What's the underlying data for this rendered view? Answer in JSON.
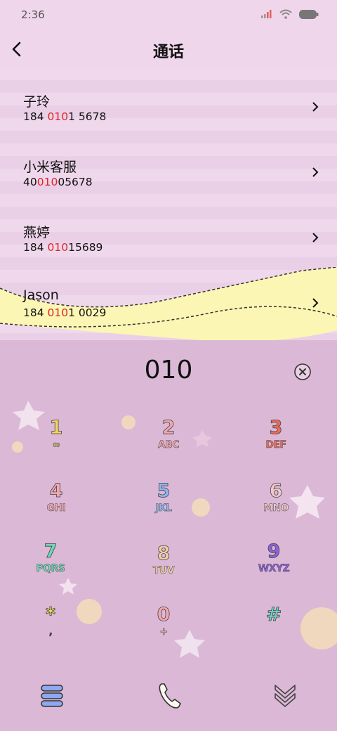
{
  "status": {
    "time": "2:36"
  },
  "header": {
    "title": "通话"
  },
  "results": [
    {
      "name": "子玲",
      "pre": "184 ",
      "hl": "010",
      "post": "1 5678"
    },
    {
      "name": "小米客服",
      "pre": "40",
      "hl": "010",
      "post": "05678"
    },
    {
      "name": "燕婷",
      "pre": "184 ",
      "hl": "010",
      "post": "15689"
    },
    {
      "name": "Jason",
      "pre": "184 ",
      "hl": "010",
      "post": "1 0029"
    }
  ],
  "dialer": {
    "digits": "010"
  },
  "keys": [
    {
      "digit": "1",
      "letters": "∞",
      "dcolor": "#f3d36a",
      "lcolor": "#f3d36a"
    },
    {
      "digit": "2",
      "letters": "ABC",
      "dcolor": "#f2a7b0",
      "lcolor": "#f2a7b0"
    },
    {
      "digit": "3",
      "letters": "DEF",
      "dcolor": "#ee6a5a",
      "lcolor": "#ee6a5a"
    },
    {
      "digit": "4",
      "letters": "GHI",
      "dcolor": "#f2a7b0",
      "lcolor": "#f2a7b0"
    },
    {
      "digit": "5",
      "letters": "JKL",
      "dcolor": "#8fb4ee",
      "lcolor": "#8fb4ee"
    },
    {
      "digit": "6",
      "letters": "MNO",
      "dcolor": "#f0c8cc",
      "lcolor": "#f0c8cc"
    },
    {
      "digit": "7",
      "letters": "PQRS",
      "dcolor": "#6fd6b8",
      "lcolor": "#6fd6b8"
    },
    {
      "digit": "8",
      "letters": "TUV",
      "dcolor": "#f0cfa8",
      "lcolor": "#f0cfa8"
    },
    {
      "digit": "9",
      "letters": "WXYZ",
      "dcolor": "#8b62d6",
      "lcolor": "#8b62d6"
    },
    {
      "digit": "*",
      "letters": ",",
      "dcolor": "#f3e04a",
      "lcolor": "#444444"
    },
    {
      "digit": "0",
      "letters": "+",
      "dcolor": "#f2a7b0",
      "lcolor": "#f2a7b0"
    },
    {
      "digit": "#",
      "letters": "",
      "dcolor": "#6fd6c8",
      "lcolor": "#6fd6c8"
    }
  ],
  "icons": {
    "back": "chevron-left-icon",
    "clear": "clear-circle-icon",
    "menu": "menu-icon",
    "call": "phone-icon",
    "collapse": "double-chevron-down-icon"
  },
  "colors": {
    "highlight": "#e0242a",
    "pad_bg": "#dbb8d6",
    "list_bg": "#efd6ea",
    "wave": "#fbf6b4"
  }
}
